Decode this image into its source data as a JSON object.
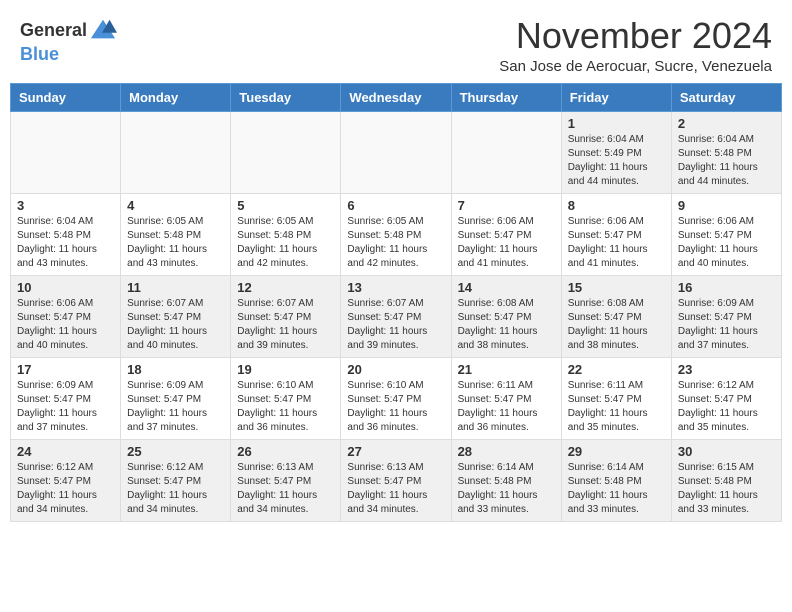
{
  "logo": {
    "general": "General",
    "blue": "Blue"
  },
  "title": "November 2024",
  "location": "San Jose de Aerocuar, Sucre, Venezuela",
  "headers": [
    "Sunday",
    "Monday",
    "Tuesday",
    "Wednesday",
    "Thursday",
    "Friday",
    "Saturday"
  ],
  "weeks": [
    [
      {
        "day": "",
        "info": ""
      },
      {
        "day": "",
        "info": ""
      },
      {
        "day": "",
        "info": ""
      },
      {
        "day": "",
        "info": ""
      },
      {
        "day": "",
        "info": ""
      },
      {
        "day": "1",
        "info": "Sunrise: 6:04 AM\nSunset: 5:49 PM\nDaylight: 11 hours\nand 44 minutes."
      },
      {
        "day": "2",
        "info": "Sunrise: 6:04 AM\nSunset: 5:48 PM\nDaylight: 11 hours\nand 44 minutes."
      }
    ],
    [
      {
        "day": "3",
        "info": "Sunrise: 6:04 AM\nSunset: 5:48 PM\nDaylight: 11 hours\nand 43 minutes."
      },
      {
        "day": "4",
        "info": "Sunrise: 6:05 AM\nSunset: 5:48 PM\nDaylight: 11 hours\nand 43 minutes."
      },
      {
        "day": "5",
        "info": "Sunrise: 6:05 AM\nSunset: 5:48 PM\nDaylight: 11 hours\nand 42 minutes."
      },
      {
        "day": "6",
        "info": "Sunrise: 6:05 AM\nSunset: 5:48 PM\nDaylight: 11 hours\nand 42 minutes."
      },
      {
        "day": "7",
        "info": "Sunrise: 6:06 AM\nSunset: 5:47 PM\nDaylight: 11 hours\nand 41 minutes."
      },
      {
        "day": "8",
        "info": "Sunrise: 6:06 AM\nSunset: 5:47 PM\nDaylight: 11 hours\nand 41 minutes."
      },
      {
        "day": "9",
        "info": "Sunrise: 6:06 AM\nSunset: 5:47 PM\nDaylight: 11 hours\nand 40 minutes."
      }
    ],
    [
      {
        "day": "10",
        "info": "Sunrise: 6:06 AM\nSunset: 5:47 PM\nDaylight: 11 hours\nand 40 minutes."
      },
      {
        "day": "11",
        "info": "Sunrise: 6:07 AM\nSunset: 5:47 PM\nDaylight: 11 hours\nand 40 minutes."
      },
      {
        "day": "12",
        "info": "Sunrise: 6:07 AM\nSunset: 5:47 PM\nDaylight: 11 hours\nand 39 minutes."
      },
      {
        "day": "13",
        "info": "Sunrise: 6:07 AM\nSunset: 5:47 PM\nDaylight: 11 hours\nand 39 minutes."
      },
      {
        "day": "14",
        "info": "Sunrise: 6:08 AM\nSunset: 5:47 PM\nDaylight: 11 hours\nand 38 minutes."
      },
      {
        "day": "15",
        "info": "Sunrise: 6:08 AM\nSunset: 5:47 PM\nDaylight: 11 hours\nand 38 minutes."
      },
      {
        "day": "16",
        "info": "Sunrise: 6:09 AM\nSunset: 5:47 PM\nDaylight: 11 hours\nand 37 minutes."
      }
    ],
    [
      {
        "day": "17",
        "info": "Sunrise: 6:09 AM\nSunset: 5:47 PM\nDaylight: 11 hours\nand 37 minutes."
      },
      {
        "day": "18",
        "info": "Sunrise: 6:09 AM\nSunset: 5:47 PM\nDaylight: 11 hours\nand 37 minutes."
      },
      {
        "day": "19",
        "info": "Sunrise: 6:10 AM\nSunset: 5:47 PM\nDaylight: 11 hours\nand 36 minutes."
      },
      {
        "day": "20",
        "info": "Sunrise: 6:10 AM\nSunset: 5:47 PM\nDaylight: 11 hours\nand 36 minutes."
      },
      {
        "day": "21",
        "info": "Sunrise: 6:11 AM\nSunset: 5:47 PM\nDaylight: 11 hours\nand 36 minutes."
      },
      {
        "day": "22",
        "info": "Sunrise: 6:11 AM\nSunset: 5:47 PM\nDaylight: 11 hours\nand 35 minutes."
      },
      {
        "day": "23",
        "info": "Sunrise: 6:12 AM\nSunset: 5:47 PM\nDaylight: 11 hours\nand 35 minutes."
      }
    ],
    [
      {
        "day": "24",
        "info": "Sunrise: 6:12 AM\nSunset: 5:47 PM\nDaylight: 11 hours\nand 34 minutes."
      },
      {
        "day": "25",
        "info": "Sunrise: 6:12 AM\nSunset: 5:47 PM\nDaylight: 11 hours\nand 34 minutes."
      },
      {
        "day": "26",
        "info": "Sunrise: 6:13 AM\nSunset: 5:47 PM\nDaylight: 11 hours\nand 34 minutes."
      },
      {
        "day": "27",
        "info": "Sunrise: 6:13 AM\nSunset: 5:47 PM\nDaylight: 11 hours\nand 34 minutes."
      },
      {
        "day": "28",
        "info": "Sunrise: 6:14 AM\nSunset: 5:48 PM\nDaylight: 11 hours\nand 33 minutes."
      },
      {
        "day": "29",
        "info": "Sunrise: 6:14 AM\nSunset: 5:48 PM\nDaylight: 11 hours\nand 33 minutes."
      },
      {
        "day": "30",
        "info": "Sunrise: 6:15 AM\nSunset: 5:48 PM\nDaylight: 11 hours\nand 33 minutes."
      }
    ]
  ]
}
